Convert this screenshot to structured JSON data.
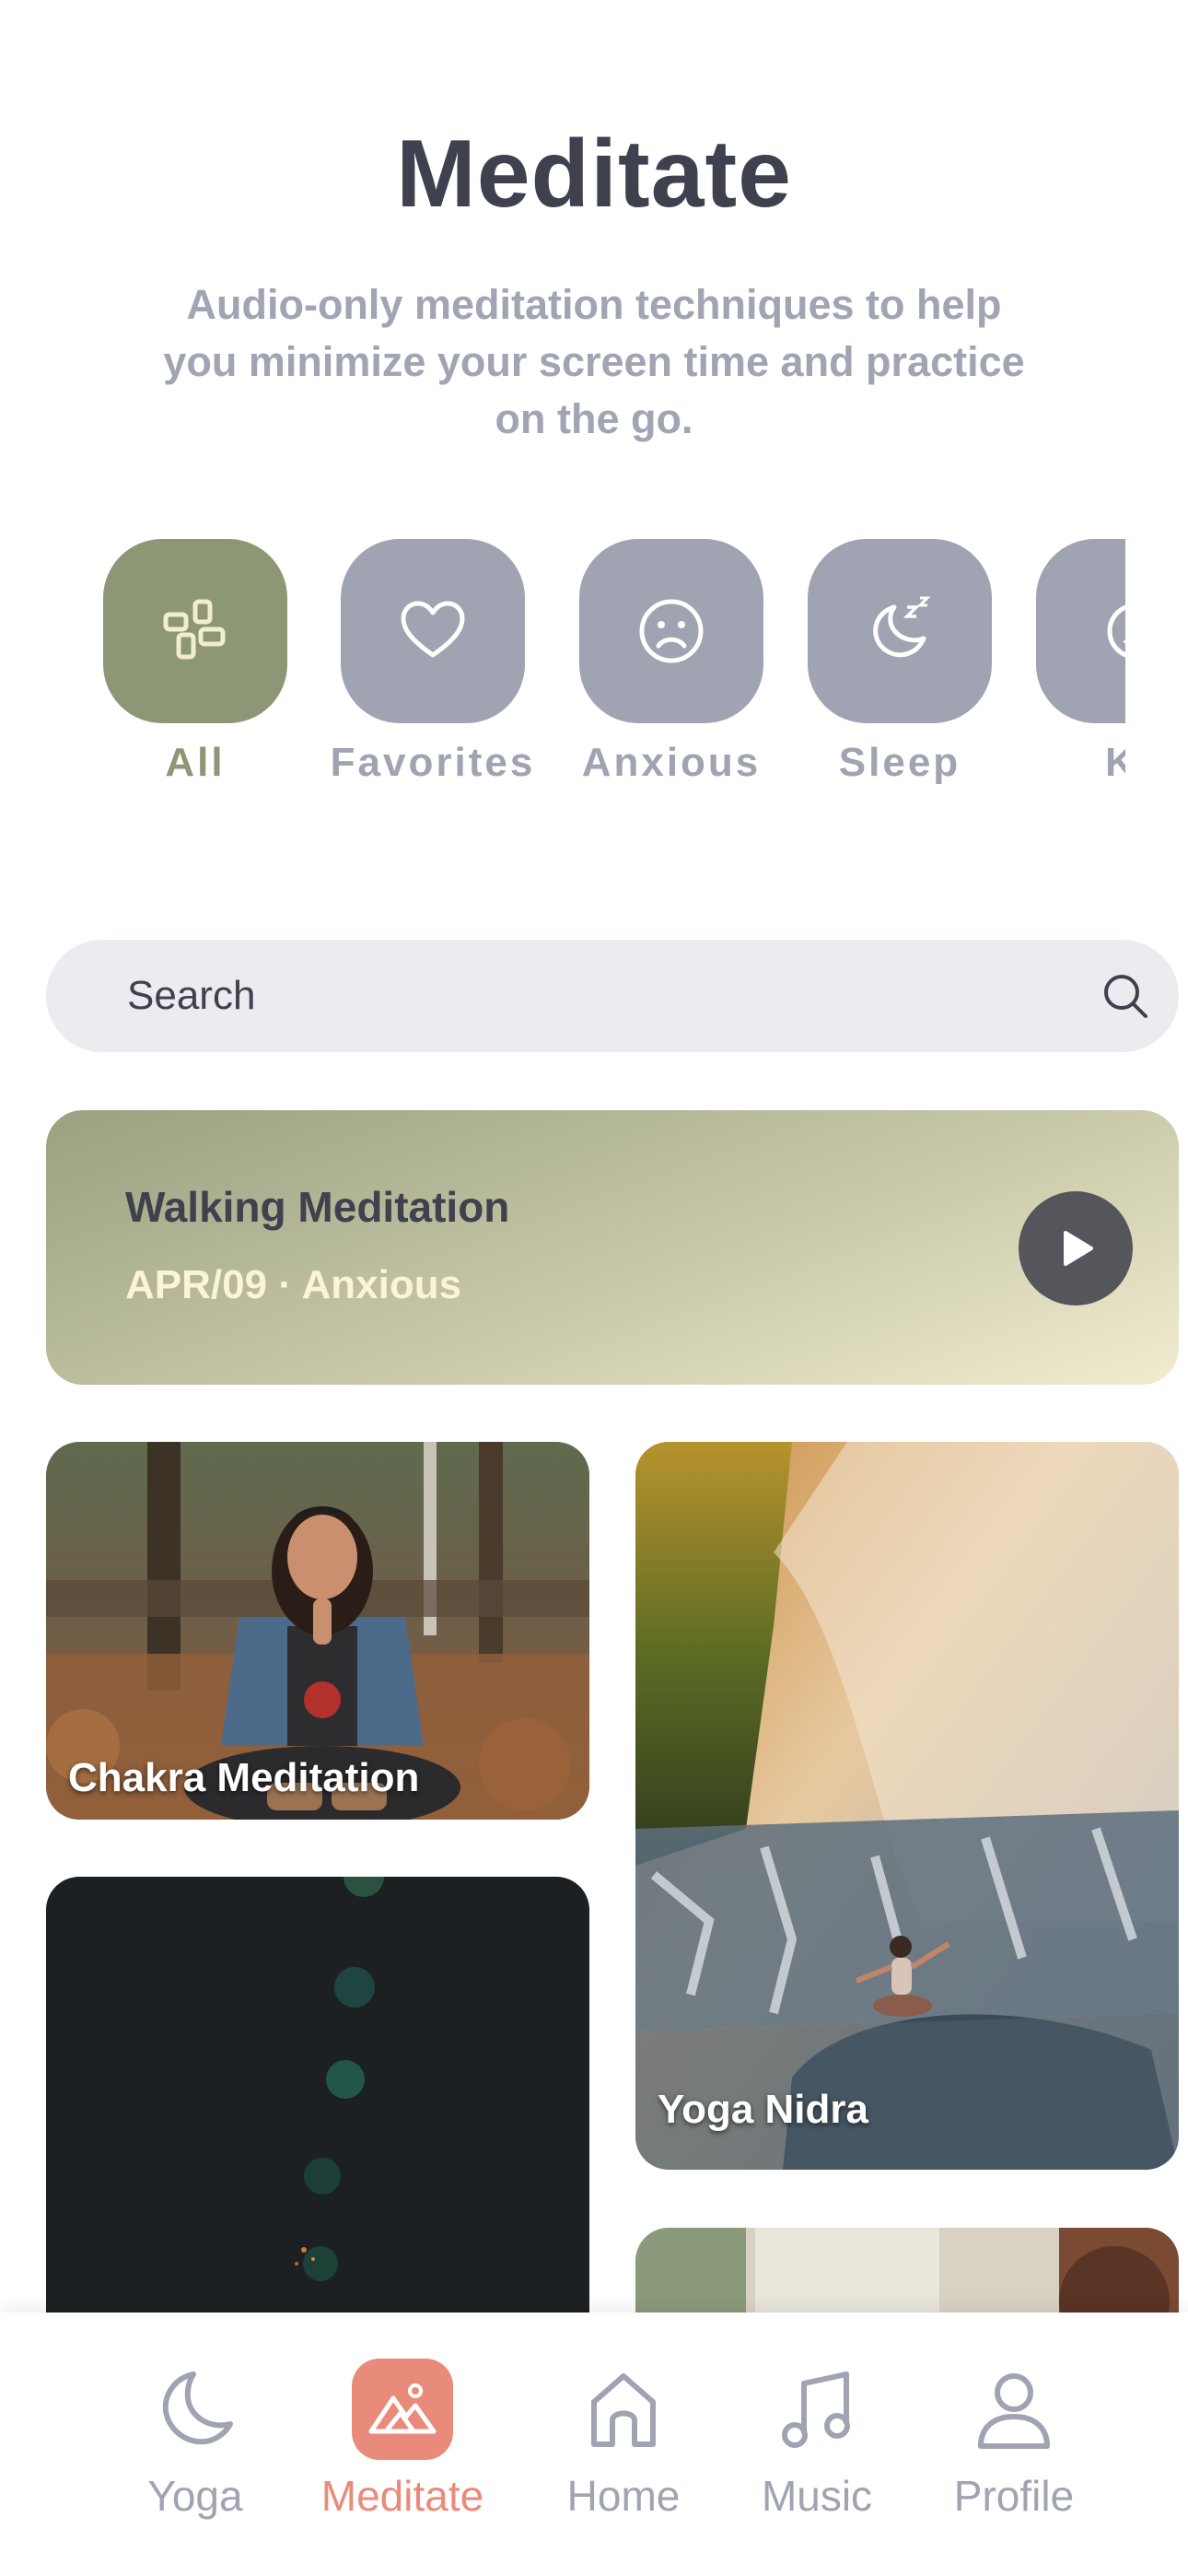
{
  "header": {
    "title": "Meditate",
    "subtitle": "Audio-only meditation techniques to help you minimize your screen time and practice on the go."
  },
  "categories": [
    {
      "label": "All",
      "icon": "grid-icon",
      "active": true
    },
    {
      "label": "Favorites",
      "icon": "heart-icon",
      "active": false
    },
    {
      "label": "Anxious",
      "icon": "sad-face-icon",
      "active": false
    },
    {
      "label": "Sleep",
      "icon": "moon-sleep-icon",
      "active": false
    },
    {
      "label": "Ki",
      "icon": "baby-face-icon",
      "active": false
    }
  ],
  "search": {
    "placeholder": "Search"
  },
  "featured": {
    "title": "Walking Meditation",
    "meta": "APR/09 · Anxious"
  },
  "cards": [
    {
      "label": "Chakra Meditation"
    },
    {
      "label": "Yoga Nidra"
    },
    {
      "label": ""
    },
    {
      "label": ""
    }
  ],
  "tabbar": {
    "items": [
      {
        "label": "Yoga",
        "icon": "moon-icon"
      },
      {
        "label": "Meditate",
        "icon": "mountain-icon",
        "active": true
      },
      {
        "label": "Home",
        "icon": "home-icon"
      },
      {
        "label": "Music",
        "icon": "music-note-icon"
      },
      {
        "label": "Profile",
        "icon": "person-icon"
      }
    ]
  },
  "colors": {
    "accent_active_category": "#8e9775",
    "inactive": "#a0a3b1",
    "tab_active": "#e98b7a",
    "text_dark": "#3f414e"
  }
}
